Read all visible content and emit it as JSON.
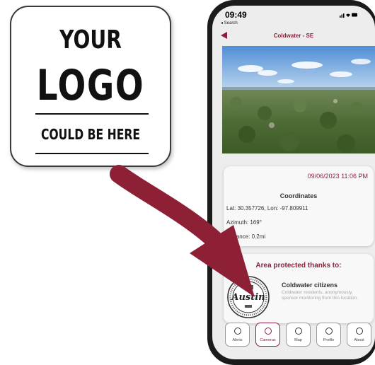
{
  "logo_card": {
    "line1": "YOUR",
    "line2": "LOGO",
    "line3": "COULD BE HERE"
  },
  "phone": {
    "status": {
      "time": "09:49",
      "back_label": "◂ Search"
    },
    "header": {
      "title": "Coldwater - SE"
    },
    "camera": {
      "image": "aerial-forest-landscape"
    },
    "info": {
      "timestamp": "09/06/2023 11:06 PM",
      "heading": "Coordinates",
      "lat_lon": "Lat: 30.357726, Lon: -97.809911",
      "azimuth": "Azimuth: 169°",
      "distance": "Distance: 0.2mi"
    },
    "sponsor": {
      "heading": "Area protected thanks to:",
      "name": "Coldwater citizens",
      "description": "Coldwater residents, anonymously, sponsor monitoring from this location.",
      "seal_text": "Austin"
    },
    "nav": [
      {
        "label": "Alerts",
        "icon": "bell-icon"
      },
      {
        "label": "Cameras",
        "icon": "camera-icon"
      },
      {
        "label": "Map",
        "icon": "map-icon"
      },
      {
        "label": "Profile",
        "icon": "profile-icon"
      },
      {
        "label": "About",
        "icon": "info-icon"
      }
    ]
  },
  "colors": {
    "accent": "#8e1f3a",
    "arrow": "#8e2036"
  }
}
